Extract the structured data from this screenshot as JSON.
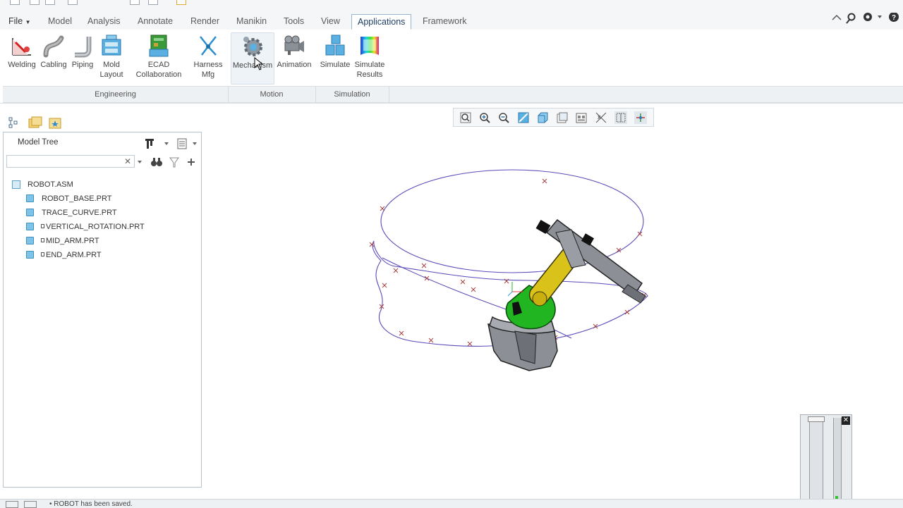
{
  "tabs": {
    "file": "File",
    "model": "Model",
    "analysis": "Analysis",
    "annotate": "Annotate",
    "render": "Render",
    "manikin": "Manikin",
    "tools": "Tools",
    "view": "View",
    "applications": "Applications",
    "framework": "Framework"
  },
  "ribbon": {
    "welding": "Welding",
    "cabling": "Cabling",
    "piping": "Piping",
    "mold_layout": [
      "Mold",
      "Layout"
    ],
    "ecad": [
      "ECAD",
      "Collaboration"
    ],
    "harness": [
      "Harness",
      "Mfg"
    ],
    "mechanism": "Mechanism",
    "animation": "Animation",
    "simulate": "Simulate",
    "simulate_results": [
      "Simulate",
      "Results"
    ]
  },
  "groups": {
    "engineering": "Engineering",
    "motion": "Motion",
    "simulation": "Simulation"
  },
  "panel": {
    "title": "Model Tree",
    "search_placeholder": ""
  },
  "tree": {
    "root": "ROBOT.ASM",
    "items": [
      {
        "label": "ROBOT_BASE.PRT"
      },
      {
        "label": "TRACE_CURVE.PRT"
      },
      {
        "label": "VERTICAL_ROTATION.PRT"
      },
      {
        "label": "MID_ARM.PRT"
      },
      {
        "label": "END_ARM.PRT"
      }
    ]
  },
  "status": {
    "message": "• ROBOT has been saved."
  },
  "colors": {
    "accent": "#1d3e66",
    "curve": "#5a4ab8",
    "arm_yellow": "#d9c21a",
    "arm_green": "#21b521",
    "body_gray": "#8c9096"
  }
}
